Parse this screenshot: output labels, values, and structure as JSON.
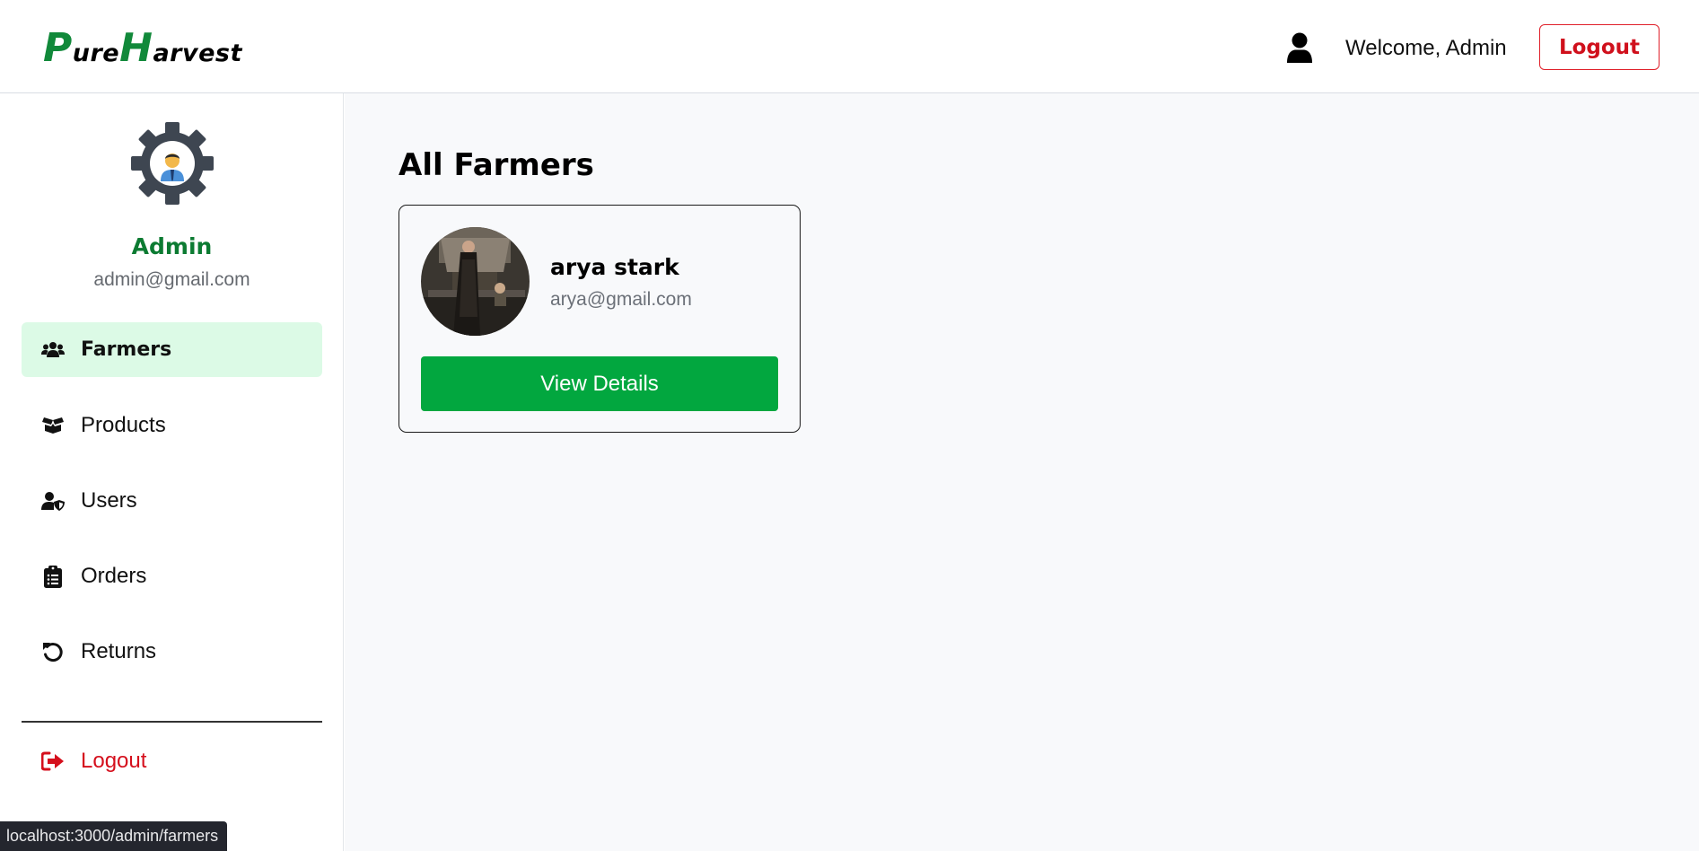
{
  "header": {
    "logo": {
      "cap1": "P",
      "rest1": "ure",
      "cap2": "H",
      "rest2": "arvest"
    },
    "welcome_text": "Welcome, Admin",
    "logout_label": "Logout"
  },
  "sidebar": {
    "admin_name": "Admin",
    "admin_email": "admin@gmail.com",
    "items": [
      {
        "label": "Farmers",
        "icon": "users-icon",
        "active": true
      },
      {
        "label": "Products",
        "icon": "box-open-icon",
        "active": false
      },
      {
        "label": "Users",
        "icon": "user-shield-icon",
        "active": false
      },
      {
        "label": "Orders",
        "icon": "clipboard-list-icon",
        "active": false
      },
      {
        "label": "Returns",
        "icon": "undo-icon",
        "active": false
      }
    ],
    "logout_label": "Logout"
  },
  "main": {
    "title": "All Farmers",
    "farmers": [
      {
        "name": "arya stark",
        "email": "arya@gmail.com",
        "button_label": "View Details"
      }
    ]
  },
  "status_bar": {
    "url": "localhost:3000/admin/farmers"
  },
  "colors": {
    "brand_green": "#11893a",
    "button_green": "#02a73f",
    "active_nav_bg": "#dcfae6",
    "logout_red": "#d50f1c"
  }
}
